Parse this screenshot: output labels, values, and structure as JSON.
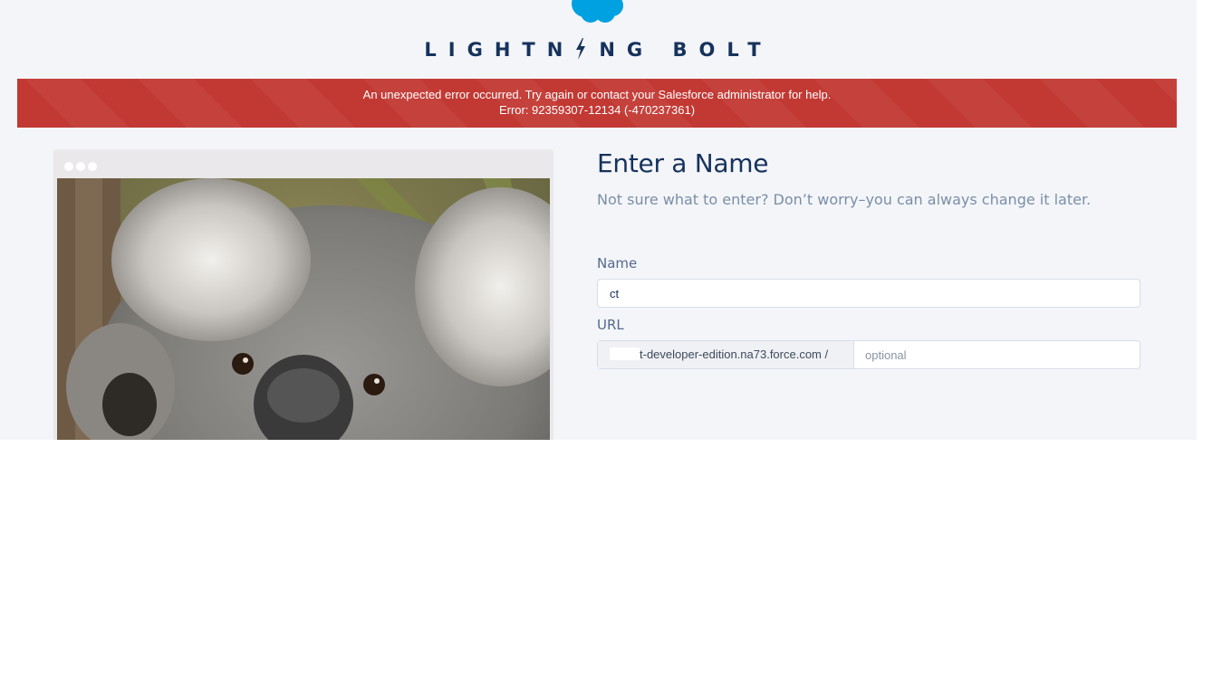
{
  "header": {
    "logo_text": "salesforce",
    "title_before_bolt": "LIGHTN",
    "title_after_bolt": "NG BOLT"
  },
  "error": {
    "message": "An unexpected error occurred. Try again or contact your Salesforce administrator for help.",
    "code": "Error: 92359307-12134 (-470237361)"
  },
  "form": {
    "title": "Enter a Name",
    "subtitle": "Not sure what to enter? Don’t worry–you can always change it later.",
    "name_label": "Name",
    "name_value": "ct",
    "url_label": "URL",
    "url_prefix": "t-developer-edition.na73.force.com  /",
    "url_placeholder": "optional"
  },
  "colors": {
    "brand_navy": "#16325c",
    "error_red": "#c23934",
    "salesforce_blue": "#00a1e0"
  }
}
